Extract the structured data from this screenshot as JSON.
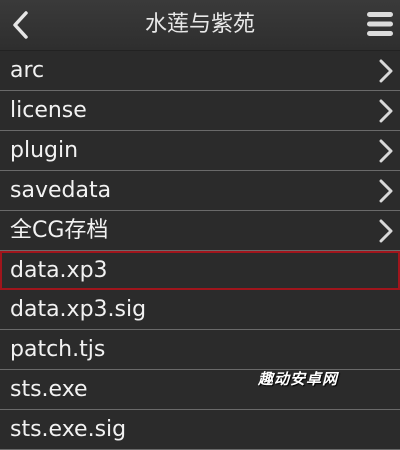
{
  "header": {
    "title": "水莲与紫苑",
    "back_icon": "chevron-left-icon",
    "menu_icon": "hamburger-menu-icon"
  },
  "list": {
    "items": [
      {
        "label": "arc",
        "type": "folder"
      },
      {
        "label": "license",
        "type": "folder"
      },
      {
        "label": "plugin",
        "type": "folder"
      },
      {
        "label": "savedata",
        "type": "folder"
      },
      {
        "label": "全CG存档",
        "type": "folder"
      },
      {
        "label": "data.xp3",
        "type": "file",
        "selected": true
      },
      {
        "label": "data.xp3.sig",
        "type": "file"
      },
      {
        "label": "patch.tjs",
        "type": "file"
      },
      {
        "label": "sts.exe",
        "type": "file"
      },
      {
        "label": "sts.exe.sig",
        "type": "file"
      }
    ]
  },
  "watermark": "趣动安卓网",
  "colors": {
    "background": "#2b2b2b",
    "text": "#f2f2f2",
    "divider": "#6a6a6a",
    "selection_border": "#a0151c"
  }
}
